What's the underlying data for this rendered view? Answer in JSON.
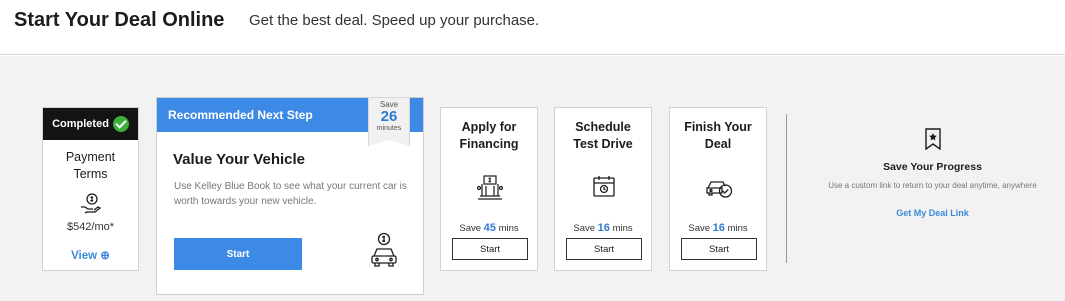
{
  "header": {
    "title": "Start Your Deal Online",
    "subtitle": "Get the best deal. Speed up your purchase."
  },
  "completed_card": {
    "status": "Completed",
    "name_line1": "Payment",
    "name_line2": "Terms",
    "amount": "$542/mo*",
    "view_label": "View",
    "icon": "money-hand-icon"
  },
  "recommended_card": {
    "header": "Recommended Next Step",
    "badge": {
      "save": "Save",
      "minutes_value": "26",
      "unit": "minutes"
    },
    "title": "Value Your Vehicle",
    "description": "Use Kelley Blue Book to see what your current car is worth towards your new vehicle.",
    "button": "Start",
    "icon": "car-dollar-icon"
  },
  "steps": [
    {
      "line1": "Apply for",
      "line2": "Financing",
      "save_prefix": "Save",
      "minutes": "45",
      "unit": "mins",
      "button": "Start",
      "icon": "bank-icon"
    },
    {
      "line1": "Schedule",
      "line2": "Test Drive",
      "save_prefix": "Save",
      "minutes": "16",
      "unit": "mins",
      "button": "Start",
      "icon": "calendar-icon"
    },
    {
      "line1": "Finish Your",
      "line2": "Deal",
      "save_prefix": "Save",
      "minutes": "16",
      "unit": "mins",
      "button": "Start",
      "icon": "car-check-icon"
    }
  ],
  "save_progress": {
    "title": "Save Your Progress",
    "description": "Use a custom link to return to your deal anytime, anywhere",
    "link": "Get My Deal Link",
    "icon": "bookmark-star-icon"
  },
  "colors": {
    "accent": "#3d8ae6",
    "completed": "#3fae3a",
    "status_bar": "#141414"
  }
}
